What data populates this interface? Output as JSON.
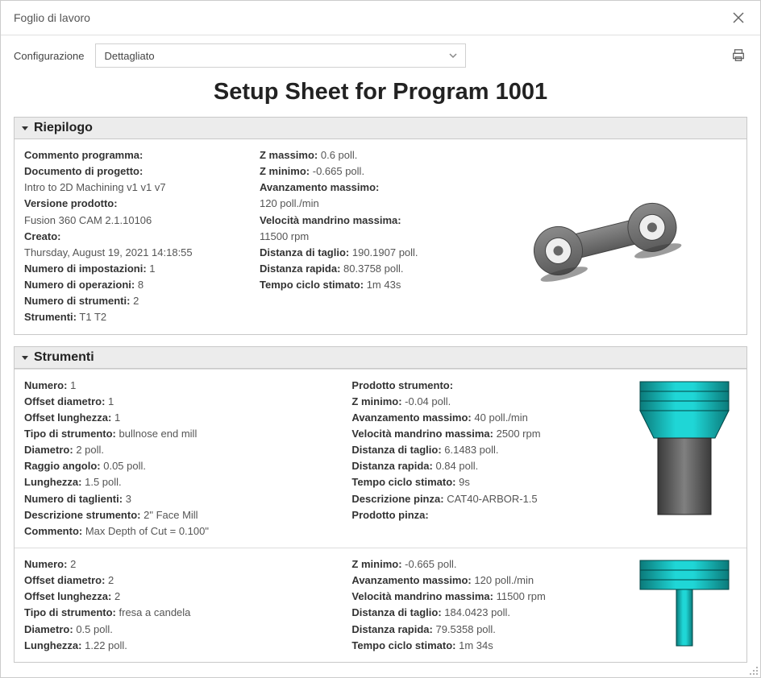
{
  "window": {
    "title": "Foglio di lavoro"
  },
  "toolbar": {
    "config_label": "Configurazione",
    "config_value": "Dettagliato"
  },
  "sheet": {
    "title": "Setup Sheet for Program 1001"
  },
  "sections": {
    "summary_title": "Riepilogo",
    "tools_title": "Strumenti"
  },
  "summary": {
    "commento_k": "Commento programma:",
    "documento_k": "Documento di progetto:",
    "documento_v": "Intro to 2D Machining v1 v1 v7",
    "versione_k": "Versione prodotto:",
    "versione_v": "Fusion 360 CAM 2.1.10106",
    "creato_k": "Creato:",
    "creato_v": "Thursday, August 19, 2021 14:18:55",
    "num_imp_k": "Numero di impostazioni:",
    "num_imp_v": "1",
    "num_op_k": "Numero di operazioni:",
    "num_op_v": "8",
    "num_str_k": "Numero di strumenti:",
    "num_str_v": "2",
    "strumenti_k": "Strumenti:",
    "strumenti_v": "T1 T2",
    "zmax_k": "Z massimo:",
    "zmax_v": "0.6 poll.",
    "zmin_k": "Z minimo:",
    "zmin_v": "-0.665 poll.",
    "avanz_k": "Avanzamento massimo:",
    "avanz_v": "120 poll./min",
    "velmand_k": "Velocità mandrino massima:",
    "velmand_v": "11500 rpm",
    "dist_taglio_k": "Distanza di taglio:",
    "dist_taglio_v": "190.1907 poll.",
    "dist_rapida_k": "Distanza rapida:",
    "dist_rapida_v": "80.3758 poll.",
    "tempo_k": "Tempo ciclo stimato:",
    "tempo_v": "1m 43s"
  },
  "tools": [
    {
      "numero_k": "Numero:",
      "numero_v": "1",
      "offd_k": "Offset diametro:",
      "offd_v": "1",
      "offl_k": "Offset lunghezza:",
      "offl_v": "1",
      "tipo_k": "Tipo di strumento:",
      "tipo_v": "bullnose end mill",
      "diam_k": "Diametro:",
      "diam_v": "2 poll.",
      "raggio_k": "Raggio angolo:",
      "raggio_v": "0.05 poll.",
      "lung_k": "Lunghezza:",
      "lung_v": "1.5 poll.",
      "numtagl_k": "Numero di taglienti:",
      "numtagl_v": "3",
      "desc_k": "Descrizione strumento:",
      "desc_v": "2\" Face Mill",
      "comm_k": "Commento:",
      "comm_v": "Max Depth of Cut = 0.100\"",
      "prodstr_k": "Prodotto strumento:",
      "zmin_k": "Z minimo:",
      "zmin_v": "-0.04 poll.",
      "avanz_k": "Avanzamento massimo:",
      "avanz_v": "40 poll./min",
      "velmand_k": "Velocità mandrino massima:",
      "velmand_v": "2500 rpm",
      "dtaglio_k": "Distanza di taglio:",
      "dtaglio_v": "6.1483 poll.",
      "drapida_k": "Distanza rapida:",
      "drapida_v": "0.84 poll.",
      "tempo_k": "Tempo ciclo stimato:",
      "tempo_v": "9s",
      "descpinza_k": "Descrizione pinza:",
      "descpinza_v": "CAT40-ARBOR-1.5",
      "prodpinza_k": "Prodotto pinza:"
    },
    {
      "numero_k": "Numero:",
      "numero_v": "2",
      "offd_k": "Offset diametro:",
      "offd_v": "2",
      "offl_k": "Offset lunghezza:",
      "offl_v": "2",
      "tipo_k": "Tipo di strumento:",
      "tipo_v": "fresa a candela",
      "diam_k": "Diametro:",
      "diam_v": "0.5 poll.",
      "lung_k": "Lunghezza:",
      "lung_v": "1.22 poll.",
      "zmin_k": "Z minimo:",
      "zmin_v": "-0.665 poll.",
      "avanz_k": "Avanzamento massimo:",
      "avanz_v": "120 poll./min",
      "velmand_k": "Velocità mandrino massima:",
      "velmand_v": "11500 rpm",
      "dtaglio_k": "Distanza di taglio:",
      "dtaglio_v": "184.0423 poll.",
      "drapida_k": "Distanza rapida:",
      "drapida_v": "79.5358 poll.",
      "tempo_k": "Tempo ciclo stimato:",
      "tempo_v": "1m 34s"
    }
  ]
}
